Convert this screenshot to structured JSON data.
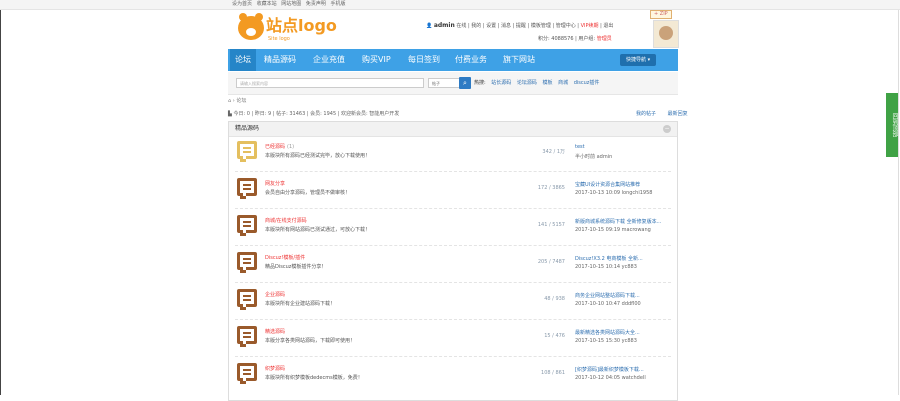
{
  "topbar": {
    "links": [
      "设为首页",
      "收藏本站",
      "网站地图",
      "免责声明",
      "手机版"
    ],
    "right_tag": "+ ZIP"
  },
  "header": {
    "logo_text": "站点logo",
    "logo_sub": "Site logo",
    "username": "admin",
    "user_links": [
      "在线",
      "我的",
      "设置",
      "消息",
      "提醒",
      "模板管理",
      "管理中心",
      "VIP续期",
      "退出"
    ],
    "credits_label": "积分: 4088576",
    "group_label": "用户组:",
    "group_value": "管理员"
  },
  "nav": {
    "items": [
      "论坛",
      "精品源码",
      "企业充值",
      "购买VIP",
      "每日签到",
      "付费业务",
      "旗下网站"
    ],
    "active_index": 0,
    "quick_label": "快捷导航 ▾"
  },
  "search": {
    "placeholder": "请输入搜索内容",
    "select_value": "帖子",
    "hot_label": "热搜:",
    "hot_items": [
      "站长源码",
      "论坛源码",
      "模板",
      "商城",
      "discuz插件"
    ]
  },
  "breadcrumb": "⌂ › 论坛",
  "stats": {
    "text": "今日: 0 | 昨日: 9 | 帖子: 31463 | 会员: 1945 | 欢迎新会员: 智能用户开发",
    "links": [
      "我的帖子",
      "最新回复"
    ]
  },
  "panel": {
    "title": "精品源码",
    "toggle": "−",
    "forums": [
      {
        "name": "已经源码",
        "badge": "(1)",
        "desc": "本版块所有源码已经测试完毕，放心下载使用！",
        "count": "342 / 1万",
        "last_title": "test",
        "last_meta": "半小时前 admin",
        "style": "first"
      },
      {
        "name": "网友分享",
        "badge": "",
        "desc": "会员自由分享源码，管理员不做审核！",
        "count": "172 / 3865",
        "last_title": "宝藏UI设计资源合集网站推荐",
        "last_meta": "2017-10-13 10:09 longchi1958",
        "style": ""
      },
      {
        "name": "商城/在线支付源码",
        "badge": "",
        "desc": "本版块所有网站源码已测试通过，可放心下载！",
        "count": "141 / 5157",
        "last_title": "新版商城系统源码下载 全新修复版本...",
        "last_meta": "2017-10-15 09:19 macrowang",
        "style": ""
      },
      {
        "name": "Discuz!模板/插件",
        "badge": "",
        "desc": "精品Discuz模板插件分享！",
        "count": "205 / 7487",
        "last_title": "Discuz!X3.2 电商模板 全新...",
        "last_meta": "2017-10-15 10:14 yc883",
        "style": ""
      },
      {
        "name": "企业源码",
        "badge": "",
        "desc": "本版块所有企业建站源码下载！",
        "count": "48 / 938",
        "last_title": "商务企业网站整站源码下载...",
        "last_meta": "2017-10-10 10:47 dddfl00",
        "style": ""
      },
      {
        "name": "精选源码",
        "badge": "",
        "desc": "本版分享各类网站源码，下载即可使用！",
        "count": "15 / 476",
        "last_title": "最新精选各类网站源码大全...",
        "last_meta": "2017-10-15 15:30 yc883",
        "style": ""
      },
      {
        "name": "织梦源码",
        "badge": "",
        "desc": "本版块所有织梦模板dedecms模板，免费！",
        "count": "108 / 861",
        "last_title": "[织梦源码]最新织梦模板下载...",
        "last_meta": "2017-10-12 04:05 watchdell",
        "style": ""
      }
    ]
  },
  "sidetab": "回到顶部"
}
